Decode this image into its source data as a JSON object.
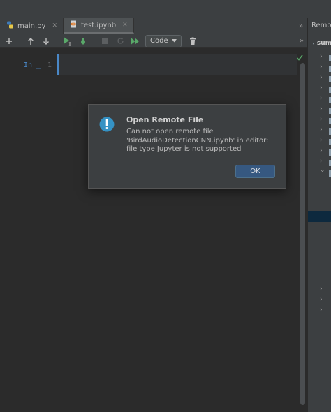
{
  "tabs": [
    {
      "label": "main.py",
      "icon": "python-file-icon",
      "active": false
    },
    {
      "label": "test.ipynb",
      "icon": "jupyter-notebook-icon",
      "active": true
    }
  ],
  "toolbar": {
    "cell_type": "Code"
  },
  "editor": {
    "prompt": "In _",
    "line_number": "1"
  },
  "right_panel": {
    "title": "Remote Host",
    "root_label": "sum"
  },
  "dialog": {
    "title": "Open Remote File",
    "message_lines": [
      "Can not open remote file",
      "'BirdAudioDetectionCNN.ipynb' in editor:",
      "file type Jupyter is not supported"
    ],
    "ok_label": "OK",
    "icon": "info-icon"
  },
  "colors": {
    "accent": "#4a88c7",
    "run_green": "#59a869",
    "dialog_button": "#365880",
    "info_icon": "#3592c4"
  }
}
